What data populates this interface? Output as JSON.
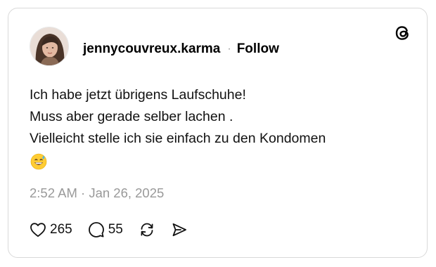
{
  "post": {
    "username": "jennycouvreux.karma",
    "separator": "·",
    "follow_label": "Follow",
    "text_lines": [
      "Ich habe jetzt übrigens Laufschuhe!",
      "Muss aber gerade selber lachen .",
      "Vielleicht stelle ich sie einfach zu den Kondomen"
    ],
    "emoji": "grinning-face-with-sweat-icon",
    "timestamp": "2:52 AM · Jan 26, 2025",
    "likes": "265",
    "replies": "55"
  },
  "icons": {
    "brand": "threads-logo-icon",
    "like": "heart-icon",
    "reply": "speech-bubble-icon",
    "repost": "repost-icon",
    "share": "send-icon"
  },
  "colors": {
    "text": "#111111",
    "muted": "#999999",
    "border": "#d9d9d9"
  }
}
